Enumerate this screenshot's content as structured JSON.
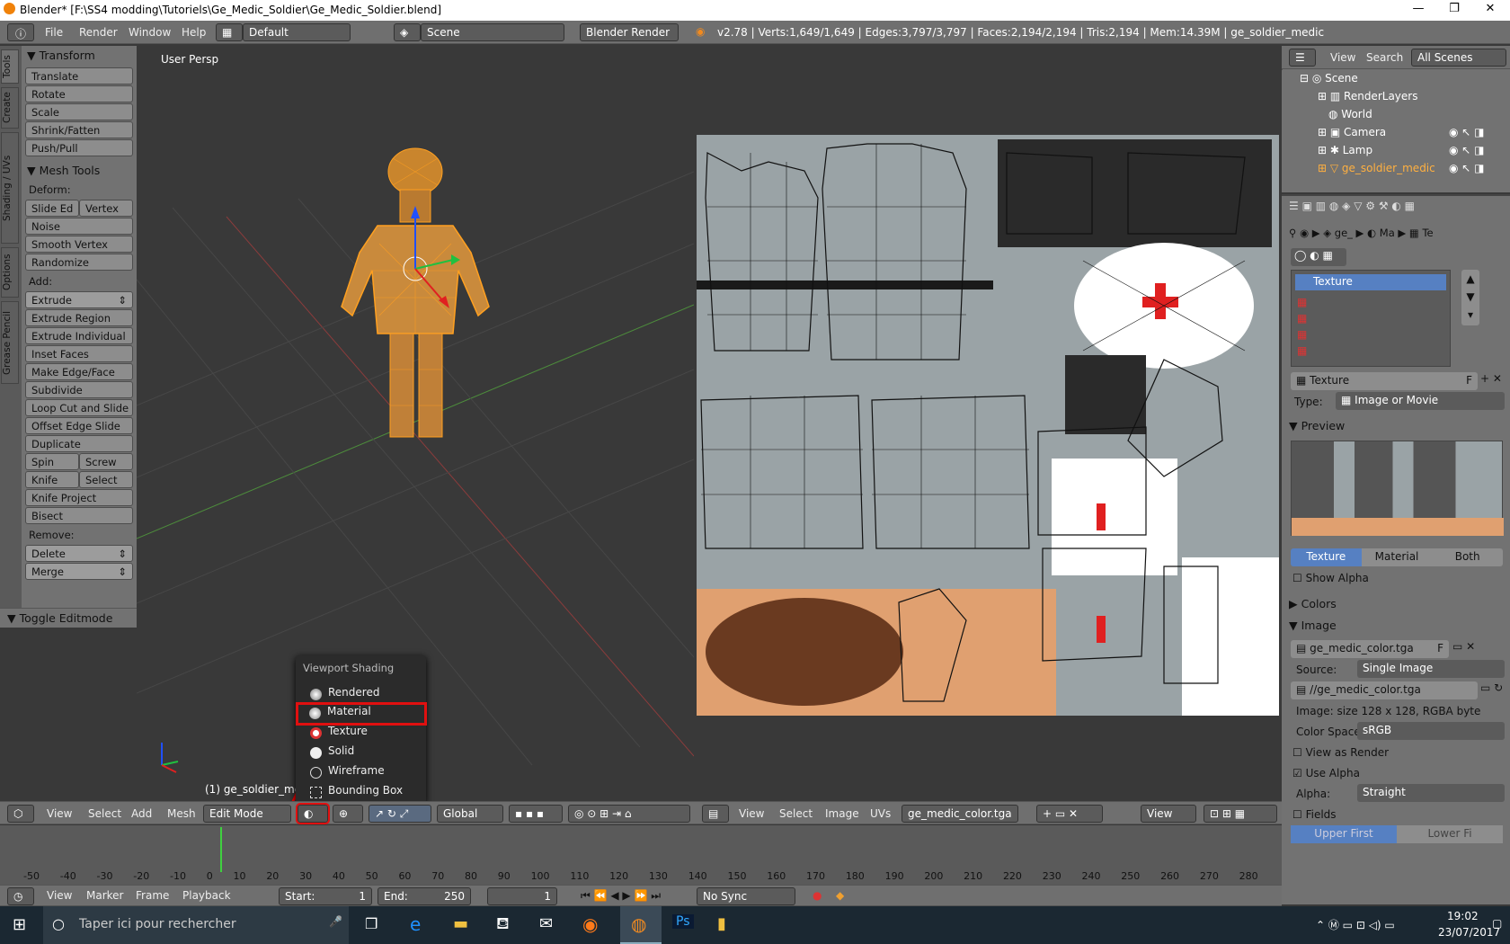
{
  "window": {
    "title": "Blender* [F:\\SS4 modding\\Tutoriels\\Ge_Medic_Soldier\\Ge_Medic_Soldier.blend]",
    "minimize": "—",
    "maximize": "❐",
    "close": "✕"
  },
  "topbar": {
    "menus": [
      "File",
      "Render",
      "Window",
      "Help"
    ],
    "layout": "Default",
    "scene": "Scene",
    "engine": "Blender Render",
    "stats": "v2.78 | Verts:1,649/1,649 | Edges:3,797/3,797 | Faces:2,194/2,194 | Tris:2,194 | Mem:14.39M | ge_soldier_medic"
  },
  "left_tabs": [
    "Tools",
    "Create",
    "Shading / UVs",
    "Options",
    "Grease Pencil"
  ],
  "toolshelf": {
    "transform_header": "Transform",
    "transform": [
      "Translate",
      "Rotate",
      "Scale",
      "Shrink/Fatten",
      "Push/Pull"
    ],
    "meshtools_header": "Mesh Tools",
    "deform_label": "Deform:",
    "slide_edge": "Slide Ed",
    "vertex": "Vertex",
    "noise": "Noise",
    "smooth_vertex": "Smooth Vertex",
    "randomize": "Randomize",
    "add_label": "Add:",
    "extrude": "Extrude",
    "add_items": [
      "Extrude Region",
      "Extrude Individual",
      "Inset Faces",
      "Make Edge/Face",
      "Subdivide",
      "Loop Cut and Slide",
      "Offset Edge Slide",
      "Duplicate"
    ],
    "spin": "Spin",
    "screw": "Screw",
    "knife": "Knife",
    "select": "Select",
    "knife_project": "Knife Project",
    "bisect": "Bisect",
    "remove_label": "Remove:",
    "delete": "Delete",
    "merge": "Merge",
    "toggle_editmode": "Toggle Editmode"
  },
  "viewport": {
    "label": "User Persp",
    "object_label": "(1) ge_soldier_medic",
    "menus": [
      "View",
      "Select",
      "Add",
      "Mesh"
    ],
    "mode": "Edit Mode",
    "orientation": "Global"
  },
  "shading_menu": {
    "title": "Viewport Shading",
    "items": [
      "Rendered",
      "Material",
      "Texture",
      "Solid",
      "Wireframe",
      "Bounding Box"
    ],
    "highlighted": "Material"
  },
  "uv_editor": {
    "menus": [
      "View",
      "Select",
      "Image",
      "UVs"
    ],
    "image": "ge_medic_color.tga",
    "f": "F",
    "view": "View"
  },
  "outliner": {
    "menus": [
      "View",
      "Search"
    ],
    "filter": "All Scenes",
    "items": [
      "Scene",
      "RenderLayers",
      "World",
      "Camera",
      "Lamp",
      "ge_soldier_medic"
    ]
  },
  "properties": {
    "breadcrumb": [
      "ge_",
      "Ma",
      "Te"
    ],
    "slot_name": "Texture",
    "texture_name": "Texture",
    "f": "F",
    "type_label": "Type:",
    "type_value": "Image or Movie",
    "preview_header": "Preview",
    "preview_tabs": [
      "Texture",
      "Material",
      "Both"
    ],
    "show_alpha": "Show Alpha",
    "colors_header": "Colors",
    "image_header": "Image",
    "image_name": "ge_medic_color.tga",
    "source_label": "Source:",
    "source_value": "Single Image",
    "filepath": "//ge_medic_color.tga",
    "image_info": "Image: size 128 x 128, RGBA byte",
    "colorspace_label": "Color Space:",
    "colorspace_value": "sRGB",
    "view_as_render": "View as Render",
    "use_alpha": "Use Alpha",
    "alpha_label": "Alpha:",
    "alpha_value": "Straight",
    "fields": "Fields",
    "upper_first": "Upper First",
    "lower_first": "Lower Fi"
  },
  "timeline": {
    "ticks": [
      "-50",
      "-40",
      "-30",
      "-20",
      "-10",
      "0",
      "10",
      "20",
      "30",
      "40",
      "50",
      "60",
      "70",
      "80",
      "90",
      "100",
      "110",
      "120",
      "130",
      "140",
      "150",
      "160",
      "170",
      "180",
      "190",
      "200",
      "210",
      "220",
      "230",
      "240",
      "250",
      "260",
      "270",
      "280"
    ],
    "menus": [
      "View",
      "Marker",
      "Frame",
      "Playback"
    ],
    "start": "Start:",
    "start_val": "1",
    "end": "End:",
    "end_val": "250",
    "current": "1",
    "sync": "No Sync"
  },
  "taskbar": {
    "search": "Taper ici pour rechercher",
    "time": "19:02",
    "date": "23/07/2017"
  },
  "colors": {
    "accent_orange": "#f0a030",
    "highlight_red": "#e01010",
    "selected_blue": "#5680c2"
  }
}
